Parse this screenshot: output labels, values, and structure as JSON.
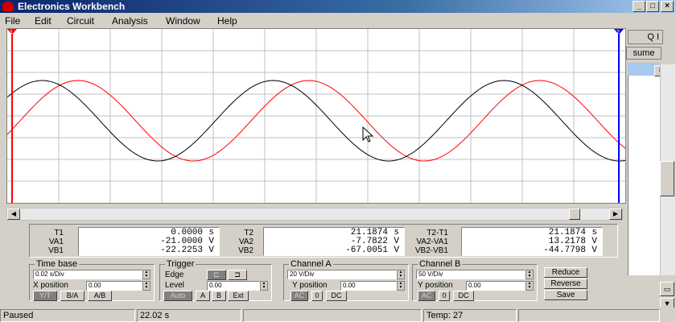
{
  "window": {
    "title": "Electronics Workbench"
  },
  "menu": [
    "File",
    "Edit",
    "Circuit",
    "Analysis",
    "Window",
    "Help"
  ],
  "window_controls": {
    "minimize": "_",
    "maximize": "□",
    "close": "×"
  },
  "side_panel": {
    "resume_label": "sume",
    "top_buttons": "Q I"
  },
  "scope": {
    "background": "#ffffff",
    "grid_color": "#c0c0c0",
    "channel_a_color": "#000000",
    "channel_b_color": "#ff0000",
    "cursor1_color": "#ff0000",
    "cursor2_color": "#0000ff",
    "cursor1_label": "1",
    "cursor2_label": "2"
  },
  "readout": {
    "t1": {
      "label": "T1",
      "value": "0.0000",
      "unit": "s"
    },
    "va1": {
      "label": "VA1",
      "value": "-21.0000",
      "unit": "V"
    },
    "vb1": {
      "label": "VB1",
      "value": "-22.2253",
      "unit": "V"
    },
    "t2": {
      "label": "T2",
      "value": "21.1874",
      "unit": "s"
    },
    "va2": {
      "label": "VA2",
      "value": "-7.7822",
      "unit": "V"
    },
    "vb2": {
      "label": "VB2",
      "value": "-67.0051",
      "unit": "V"
    },
    "t2t1": {
      "label": "T2-T1",
      "value": "21.1874",
      "unit": "s"
    },
    "va2va1": {
      "label": "VA2-VA1",
      "value": "13.2178",
      "unit": "V"
    },
    "vb2vb1": {
      "label": "VB2-VB1",
      "value": "-44.7798",
      "unit": "V"
    }
  },
  "timebase": {
    "title": "Time base",
    "scale": "0.02 s/Div",
    "xpos_label": "X position",
    "xpos": "0.00",
    "buttons": [
      "Y/T",
      "B/A",
      "A/B"
    ]
  },
  "trigger": {
    "title": "Trigger",
    "edge_label": "Edge",
    "level_label": "Level",
    "level": "0.00",
    "buttons": [
      "Auto",
      "A",
      "B",
      "Ext"
    ]
  },
  "channel_a": {
    "title": "Channel A",
    "scale": "20 V/Div",
    "ypos_label": "Y position",
    "ypos": "0.00",
    "buttons": [
      "AC",
      "0",
      "DC"
    ]
  },
  "channel_b": {
    "title": "Channel B",
    "scale": "50 V/Div",
    "ypos_label": "Y position",
    "ypos": "0.00",
    "buttons": [
      "AC",
      "0",
      "DC"
    ]
  },
  "actions": [
    "Reduce",
    "Reverse",
    "Save"
  ],
  "status": {
    "state": "Paused",
    "time": "22.02 s",
    "temp": "Temp:  27"
  }
}
